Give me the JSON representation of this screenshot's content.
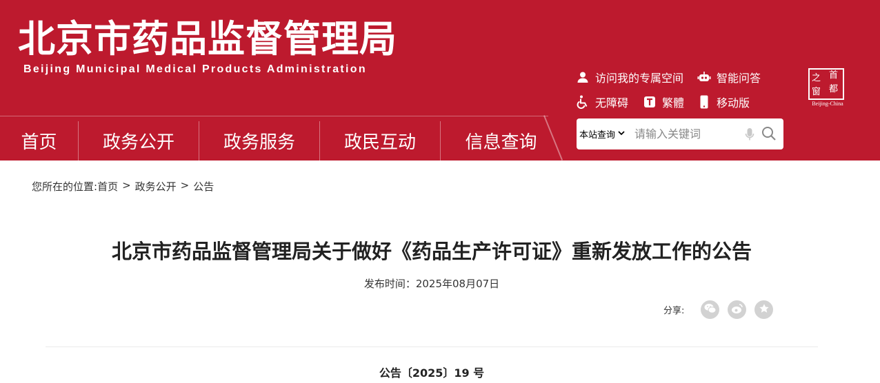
{
  "header": {
    "title_cn": "北京市药品监督管理局",
    "title_en": "Beijing Municipal Medical Products Administration",
    "brand_color": "#bd1a2e"
  },
  "tools": [
    {
      "label": "访问我的专属空间",
      "icon": "user-icon"
    },
    {
      "label": "智能问答",
      "icon": "robot-icon"
    },
    {
      "label": "无障碍",
      "icon": "wheelchair-icon"
    },
    {
      "label": "繁體",
      "icon": "traditional-t-icon"
    },
    {
      "label": "移动版",
      "icon": "mobile-icon"
    }
  ],
  "badge": {
    "chars": [
      "之",
      "首",
      "窗",
      "都"
    ],
    "caption": "Beijing-China"
  },
  "nav": [
    {
      "label": "首页"
    },
    {
      "label": "政务公开"
    },
    {
      "label": "政务服务"
    },
    {
      "label": "政民互动"
    },
    {
      "label": "信息查询"
    }
  ],
  "search": {
    "scope": "本站查询",
    "placeholder": "请输入关键词"
  },
  "breadcrumb": {
    "prefix": "您所在的位置:",
    "items": [
      "首页",
      "政务公开",
      "公告"
    ],
    "separator": ">"
  },
  "article": {
    "title": "北京市药品监督管理局关于做好《药品生产许可证》重新发放工作的公告",
    "date_label": "发布时间：2025年08月07日",
    "doc_number": "公告〔2025〕19 号"
  },
  "share": {
    "label": "分享:",
    "buttons": [
      "wechat-icon",
      "weibo-icon",
      "favorite-star-icon"
    ]
  }
}
